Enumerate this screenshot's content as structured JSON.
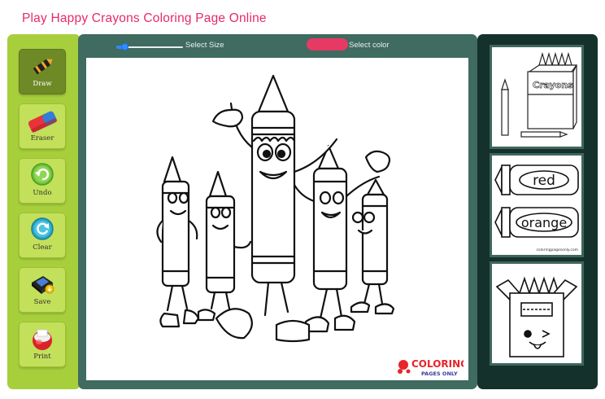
{
  "page": {
    "title": "Play Happy Crayons Coloring Page Online"
  },
  "tools": [
    {
      "label": "Draw",
      "icon": "crayon-icon",
      "active": true
    },
    {
      "label": "Eraser",
      "icon": "eraser-icon",
      "active": false
    },
    {
      "label": "Undo",
      "icon": "undo-icon",
      "active": false
    },
    {
      "label": "Clear",
      "icon": "clear-icon",
      "active": false
    },
    {
      "label": "Save",
      "icon": "save-icon",
      "active": false
    },
    {
      "label": "Print",
      "icon": "print-icon",
      "active": false
    }
  ],
  "controls": {
    "size_label": "Select Size",
    "size_value": 0.12,
    "color_label": "Select color",
    "selected_color": "#e63a64"
  },
  "canvas": {
    "logo_line1": "COLORING",
    "logo_line2": "PAGES ONLY"
  },
  "thumbnails": [
    {
      "name": "crayons-box",
      "text": "Crayons"
    },
    {
      "name": "red-orange-crayons",
      "labels": [
        "red",
        "orange"
      ],
      "caption": "coloringpagesonly.com"
    },
    {
      "name": "winking-crayon-box"
    }
  ],
  "colors": {
    "left_panel": "#a7cf3c",
    "center_panel": "#3f6b60",
    "right_panel": "#15312c",
    "title": "#e8296b"
  }
}
